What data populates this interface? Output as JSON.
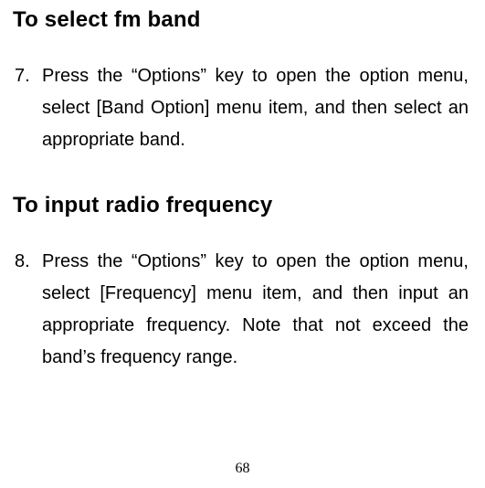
{
  "section1": {
    "heading": "To select fm band",
    "item_number": "7.",
    "item_text": "Press the “Options” key to open the option menu, select [Band Option] menu item, and then select an appropriate band."
  },
  "section2": {
    "heading": "To input radio frequency",
    "item_number": "8.",
    "item_text": "Press the “Options” key to open the option menu, select [Frequency] menu item, and then input an appropriate frequency. Note that not exceed the band’s frequency range."
  },
  "page_number": "68"
}
